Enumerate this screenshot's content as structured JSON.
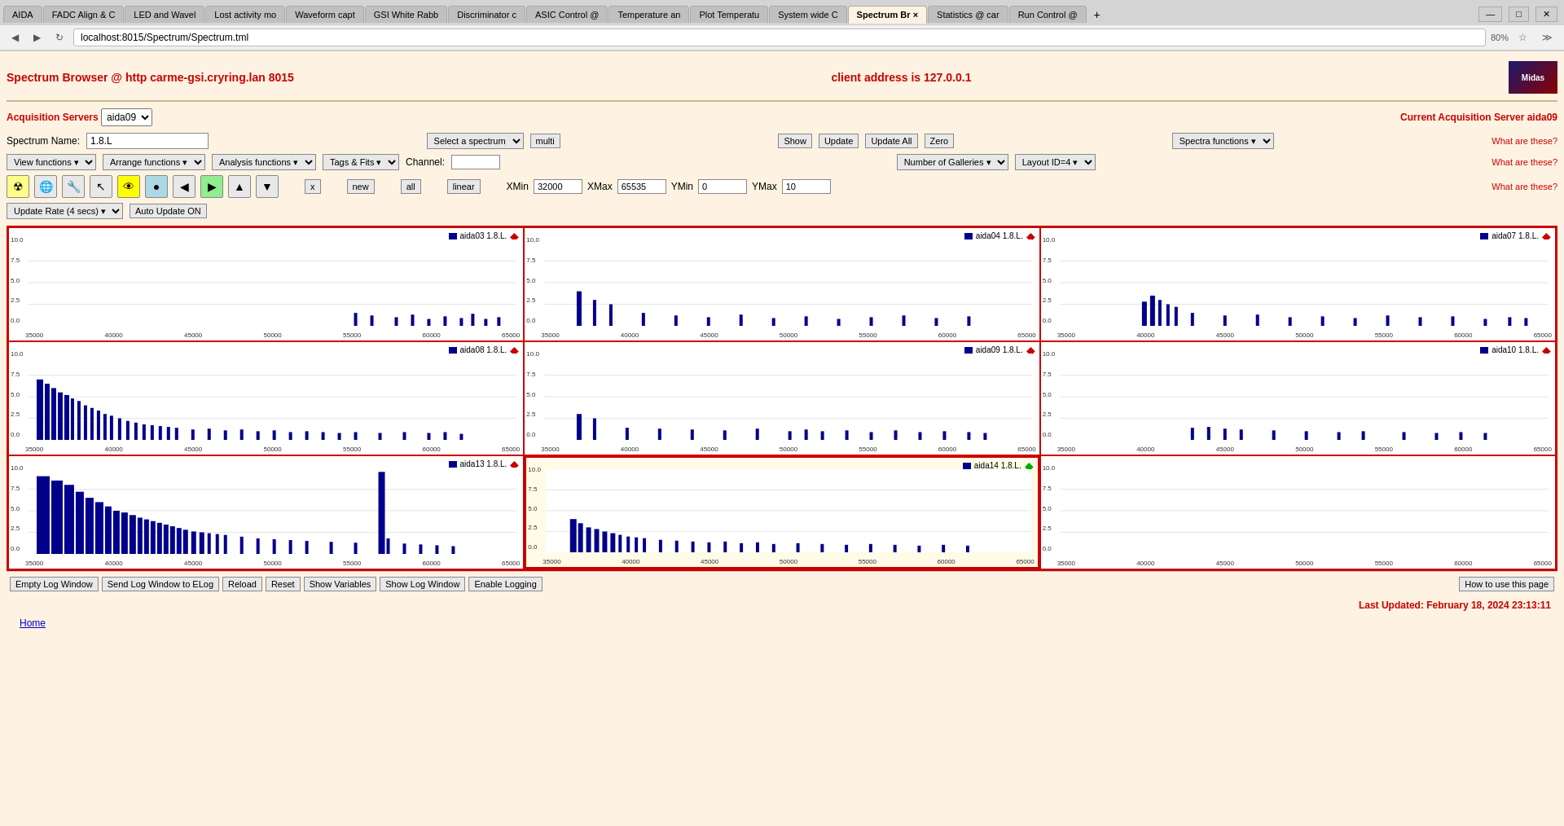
{
  "browser": {
    "tabs": [
      {
        "label": "AIDA",
        "active": false
      },
      {
        "label": "FADC Align & C",
        "active": false
      },
      {
        "label": "LED and Wavel",
        "active": false
      },
      {
        "label": "Lost activity mo",
        "active": false
      },
      {
        "label": "Waveform capt",
        "active": false
      },
      {
        "label": "GSI White Rabb",
        "active": false
      },
      {
        "label": "Discriminator c",
        "active": false
      },
      {
        "label": "ASIC Control @",
        "active": false
      },
      {
        "label": "Temperature an",
        "active": false
      },
      {
        "label": "Plot Temperatu",
        "active": false
      },
      {
        "label": "System wide C",
        "active": false
      },
      {
        "label": "Spectrum Br ×",
        "active": true
      },
      {
        "label": "Statistics @ car",
        "active": false
      },
      {
        "label": "Run Control @",
        "active": false
      }
    ],
    "url": "localhost:8015/Spectrum/Spectrum.tml",
    "zoom": "80%"
  },
  "header": {
    "title": "Spectrum Browser @ http carme-gsi.cryring.lan 8015",
    "client_address_label": "client address is 127.0.0.1"
  },
  "acquisition": {
    "label": "Acquisition Servers",
    "server_select": "aida09",
    "current_label": "Current Acquisition Server aida09"
  },
  "spectrum": {
    "name_label": "Spectrum Name:",
    "name_value": "1.8.L",
    "select_spectrum": "Select a spectrum",
    "multi": "multi",
    "show": "Show",
    "update": "Update",
    "update_all": "Update All",
    "zero": "Zero",
    "spectra_functions": "Spectra functions",
    "what_label1": "What are these?",
    "what_label2": "What are these?",
    "what_label3": "What are these?"
  },
  "functions": {
    "view": "View functions",
    "arrange": "Arrange functions",
    "analysis": "Analysis functions",
    "tags_fits": "Tags & Fits"
  },
  "channel": {
    "label": "Channel:",
    "value": ""
  },
  "number_of_galleries": {
    "label": "Number of Galleries"
  },
  "layout": {
    "label": "Layout ID=4"
  },
  "axis": {
    "xmin_label": "XMin",
    "xmin_value": "32000",
    "xmax_label": "XMax",
    "xmax_value": "65535",
    "ymin_label": "YMin",
    "ymin_value": "0",
    "ymax_label": "YMax",
    "ymax_value": "10"
  },
  "icon_buttons": [
    {
      "name": "radiation-icon",
      "symbol": "☢",
      "color": "yellow"
    },
    {
      "name": "globe-icon",
      "symbol": "🌐",
      "color": "default"
    },
    {
      "name": "tools-icon",
      "symbol": "🔧",
      "color": "default"
    },
    {
      "name": "cursor-icon",
      "symbol": "↖",
      "color": "default"
    },
    {
      "name": "eye-icon",
      "symbol": "👁",
      "color": "yellow"
    },
    {
      "name": "circle-icon",
      "symbol": "🔵",
      "color": "blue"
    },
    {
      "name": "arrow-left-icon",
      "symbol": "◀",
      "color": "default"
    },
    {
      "name": "arrow-right-icon",
      "symbol": "▶",
      "color": "green"
    },
    {
      "name": "arrow-up-icon",
      "symbol": "▲",
      "color": "default"
    },
    {
      "name": "arrow-down-icon",
      "symbol": "▼",
      "color": "default"
    }
  ],
  "small_buttons": [
    {
      "id": "x-btn",
      "label": "x"
    },
    {
      "id": "new-btn",
      "label": "new"
    },
    {
      "id": "all-btn",
      "label": "all"
    },
    {
      "id": "linear-btn",
      "label": "linear"
    }
  ],
  "update_rate": {
    "label": "Update Rate (4 secs)",
    "auto_update": "Auto Update ON"
  },
  "charts": [
    {
      "id": "aida03",
      "title": "aida03 1.8.L.",
      "diamond": "red",
      "selected": false,
      "data_type": "sparse_right",
      "y_values": [
        "10.0",
        "7.5",
        "5.0",
        "2.5",
        "0.0"
      ],
      "x_values": [
        "35000",
        "40000",
        "45000",
        "50000",
        "55000",
        "60000",
        "65000"
      ]
    },
    {
      "id": "aida04",
      "title": "aida04 1.8.L.",
      "diamond": "red",
      "selected": false,
      "data_type": "sparse_mid",
      "y_values": [
        "10.0",
        "7.5",
        "5.0",
        "2.5",
        "0.0"
      ],
      "x_values": [
        "35000",
        "40000",
        "45000",
        "50000",
        "55000",
        "60000",
        "65000"
      ]
    },
    {
      "id": "aida07",
      "title": "aida07 1.8.L.",
      "diamond": "red",
      "selected": false,
      "data_type": "sparse_all",
      "y_values": [
        "10.0",
        "7.5",
        "5.0",
        "2.5",
        "0.0"
      ],
      "x_values": [
        "35000",
        "40000",
        "45000",
        "50000",
        "55000",
        "60000",
        "65000"
      ]
    },
    {
      "id": "aida08",
      "title": "aida08 1.8.L.",
      "diamond": "red",
      "selected": false,
      "data_type": "dense_left",
      "y_values": [
        "10.0",
        "7.5",
        "5.0",
        "2.5",
        "0.0"
      ],
      "x_values": [
        "35000",
        "40000",
        "45000",
        "50000",
        "55000",
        "60000",
        "65000"
      ]
    },
    {
      "id": "aida09",
      "title": "aida09 1.8.L.",
      "diamond": "red",
      "selected": false,
      "data_type": "sparse_wide",
      "y_values": [
        "10.0",
        "7.5",
        "5.0",
        "2.5",
        "0.0"
      ],
      "x_values": [
        "35000",
        "40000",
        "45000",
        "50000",
        "55000",
        "60000",
        "65000"
      ]
    },
    {
      "id": "aida10",
      "title": "aida10 1.8.L.",
      "diamond": "red",
      "selected": false,
      "data_type": "sparse_right2",
      "y_values": [
        "10.0",
        "7.5",
        "5.0",
        "2.5",
        "0.0"
      ],
      "x_values": [
        "35000",
        "40000",
        "45000",
        "50000",
        "55000",
        "60000",
        "65000"
      ]
    },
    {
      "id": "aida13",
      "title": "aida13 1.8.L.",
      "diamond": "red",
      "selected": false,
      "data_type": "dense_curve",
      "y_values": [
        "10.0",
        "7.5",
        "5.0",
        "2.5",
        "0.0"
      ],
      "x_values": [
        "35000",
        "40000",
        "45000",
        "50000",
        "55000",
        "60000",
        "65000"
      ]
    },
    {
      "id": "aida14",
      "title": "aida14 1.8.L.",
      "diamond": "green",
      "selected": true,
      "data_type": "medium_left",
      "y_values": [
        "10.0",
        "7.5",
        "5.0",
        "2.5",
        "0.0"
      ],
      "x_values": [
        "35000",
        "40000",
        "45000",
        "50000",
        "55000",
        "60000",
        "65000"
      ]
    },
    {
      "id": "empty",
      "title": "",
      "diamond": "none",
      "selected": false,
      "data_type": "empty",
      "y_values": [
        "10.0",
        "7.5",
        "5.0",
        "2.5",
        "0.0"
      ],
      "x_values": [
        "35000",
        "40000",
        "45000",
        "50000",
        "55000",
        "60000",
        "65000"
      ]
    }
  ],
  "bottom_buttons": [
    {
      "id": "empty-log",
      "label": "Empty Log Window"
    },
    {
      "id": "send-log",
      "label": "Send Log Window to ELog"
    },
    {
      "id": "reload",
      "label": "Reload"
    },
    {
      "id": "reset",
      "label": "Reset"
    },
    {
      "id": "show-variables",
      "label": "Show Variables"
    },
    {
      "id": "show-log",
      "label": "Show Log Window"
    },
    {
      "id": "enable-logging",
      "label": "Enable Logging"
    }
  ],
  "how_to": "How to use this page",
  "last_updated": "Last Updated: February 18, 2024 23:13:11",
  "home_link": "Home"
}
